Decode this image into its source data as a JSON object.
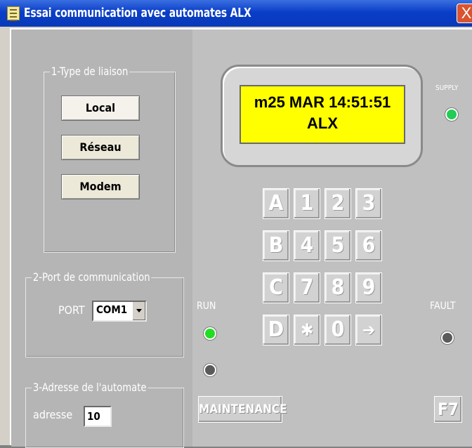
{
  "window": {
    "title": "Essai communication avec automates ALX",
    "close": "X"
  },
  "group1": {
    "label": "1-Type de liaison",
    "buttons": [
      "Local",
      "Réseau",
      "Modem"
    ]
  },
  "group2": {
    "label": "2-Port de communication",
    "port_label": "PORT",
    "port_value": "COM1"
  },
  "group3": {
    "label": "3-Adresse de l'automate",
    "address_label": "adresse",
    "address_value": "10"
  },
  "device": {
    "lcd_line1": "m25 MAR 14:51:51",
    "lcd_line2": "ALX",
    "supply_label": "SUPPLY",
    "run_label": "RUN",
    "fault_label": "FAULT",
    "maintenance_label": "MAINTENANCE",
    "f7_label": "F7",
    "keys": [
      "A",
      "1",
      "2",
      "3",
      "B",
      "4",
      "5",
      "6",
      "C",
      "7",
      "8",
      "9",
      "D",
      "✱",
      "0",
      "➔"
    ],
    "colors": {
      "lcd": "#ffff00",
      "led_on": "#22dd22",
      "led_off": "#5a5a5a",
      "supply_led": "#22cc55"
    }
  }
}
